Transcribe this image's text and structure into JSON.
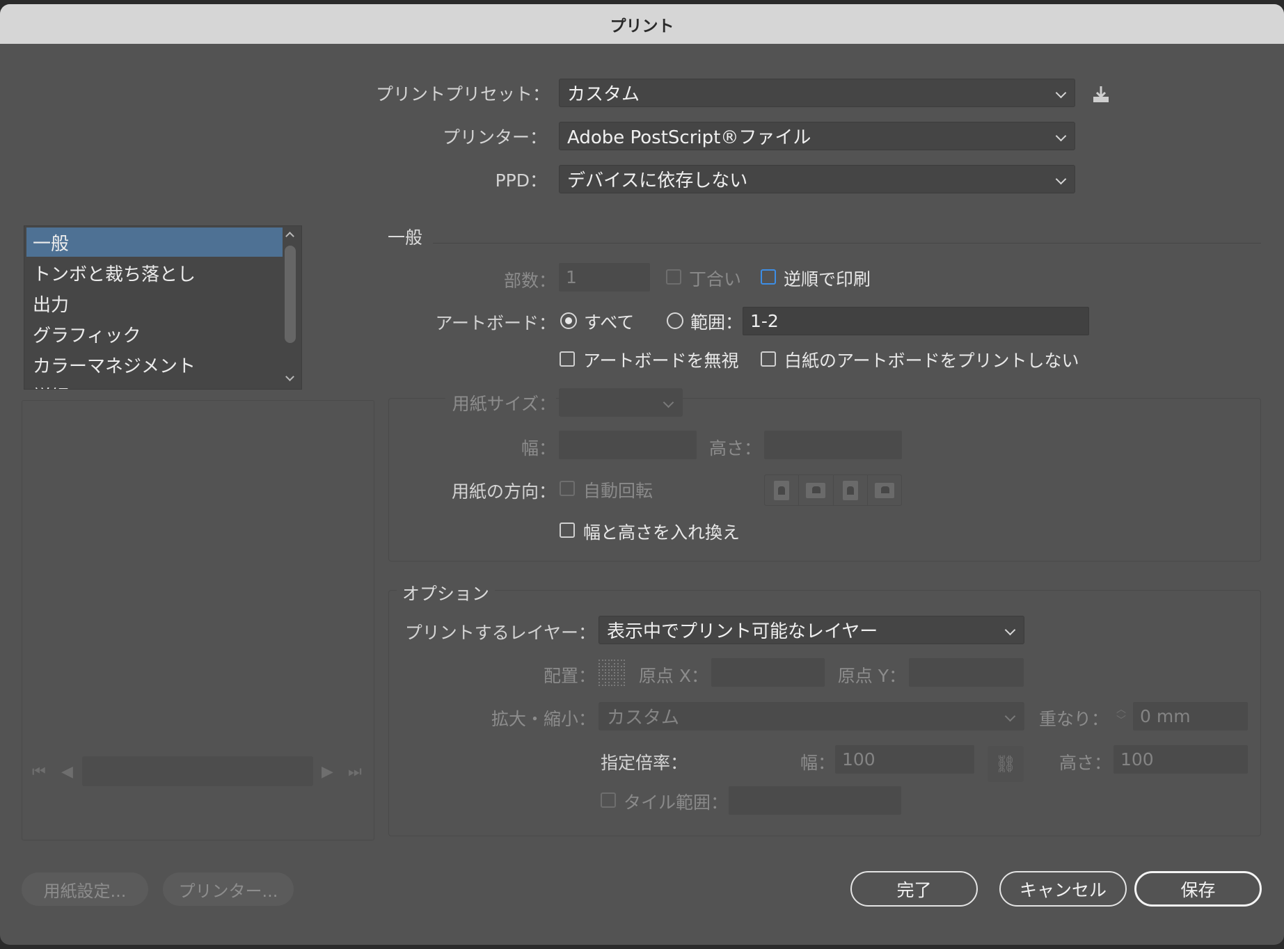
{
  "window": {
    "title": "プリント"
  },
  "top": {
    "preset_label": "プリントプリセット：",
    "preset_value": "カスタム",
    "printer_label": "プリンター：",
    "printer_value": "Adobe PostScript®ファイル",
    "ppd_label": "PPD：",
    "ppd_value": "デバイスに依存しない"
  },
  "sidebar": {
    "items": [
      {
        "label": "一般",
        "selected": true
      },
      {
        "label": "トンボと裁ち落とし"
      },
      {
        "label": "出力"
      },
      {
        "label": "グラフィック"
      },
      {
        "label": "カラーマネジメント"
      },
      {
        "label": "詳細"
      }
    ]
  },
  "general": {
    "section_title": "一般",
    "copies_label": "部数：",
    "copies_value": "1",
    "collate_label": "丁合い",
    "reverse_label": "逆順で印刷",
    "artboard_label": "アートボード：",
    "all_label": "すべて",
    "range_label": "範囲：",
    "range_value": "1-2",
    "ignore_artboards_label": "アートボードを無視",
    "skip_blank_label": "白紙のアートボードをプリントしない",
    "media_size_label": "用紙サイズ：",
    "width_label": "幅：",
    "height_label": "高さ：",
    "orientation_label": "用紙の方向：",
    "auto_rotate_label": "自動回転",
    "transverse_label": "幅と高さを入れ換え"
  },
  "options": {
    "section_title": "オプション",
    "print_layers_label": "プリントするレイヤー：",
    "print_layers_value": "表示中でプリント可能なレイヤー",
    "placement_label": "配置：",
    "origin_x_label": "原点 X：",
    "origin_y_label": "原点 Y：",
    "scaling_label": "拡大・縮小：",
    "scaling_value": "カスタム",
    "overlap_label": "重なり：",
    "overlap_value": "0 mm",
    "custom_scale_label": "指定倍率：",
    "scale_width_label": "幅：",
    "scale_width_value": "100",
    "scale_height_label": "高さ：",
    "scale_height_value": "100",
    "tile_range_label": "タイル範囲："
  },
  "footer": {
    "page_setup_label": "用紙設定...",
    "printer_button_label": "プリンター...",
    "done_label": "完了",
    "cancel_label": "キャンセル",
    "save_label": "保存"
  },
  "colors": {
    "accent": "#4e7194",
    "dialog_bg": "#535353",
    "checkbox_focus": "#3d8ee6"
  },
  "icons": [
    "download-preset-icon",
    "chevron-down-icon",
    "chevron-up-icon",
    "first-page-icon",
    "prev-page-icon",
    "next-page-icon",
    "last-page-icon",
    "link-icon",
    "placement-grid-icon"
  ]
}
